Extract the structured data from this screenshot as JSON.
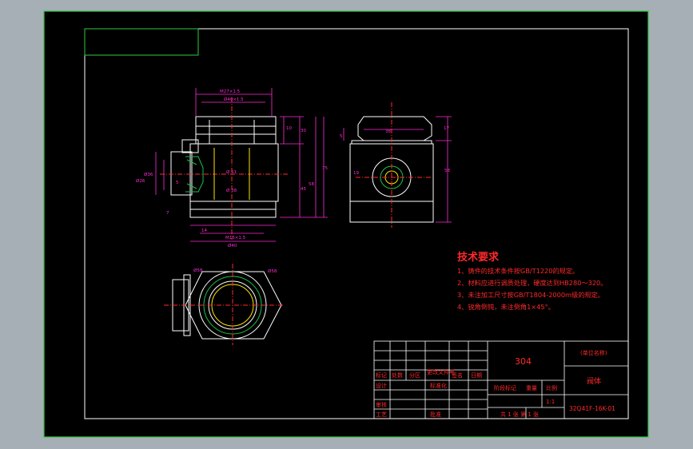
{
  "technical_requirements": {
    "title": "技术要求",
    "items": [
      "1、铸件的技术条件按GB/T1220的规定。",
      "2、材料应进行调质处理，硬度达到HB280～320。",
      "3、未注加工尺寸按GB/T1804-2000m级的规定。",
      "4、锐角倒钝，未注倒角1×45°。"
    ]
  },
  "title_block": {
    "material": "304",
    "company": "(单位名称)",
    "part_name": "阀体",
    "drawing_no": "32Q41F-16K-01",
    "scale": "1:1",
    "sheet_info": "共 1 张  第 1 张",
    "labels": {
      "mark": "标记",
      "count": "处数",
      "zone": "分区",
      "change_doc": "更改文件号",
      "signature": "签名",
      "date": "日期",
      "design": "设计",
      "standardization": "标准化",
      "review": "审核",
      "process": "工艺",
      "approve": "批准",
      "stage_mark": "阶段标记",
      "weight": "重量",
      "scale": "比例"
    }
  },
  "dimensions": {
    "top_1": "M27×1.5",
    "top_2": "Ø40×1.5",
    "side_1": "10",
    "side_2": "30",
    "side_3": "58",
    "side_4": "75",
    "side_5": "45",
    "inner_1": "Ø 51",
    "inner_2": "Ø 38",
    "left_1": "Ø26",
    "left_2": "Ø36",
    "left_3": "5",
    "left_4": "7",
    "bottom_1": "14",
    "bottom_2": "M16×1.5",
    "bottom_3": "Ø40",
    "right_1": "5",
    "right_2": "17",
    "right_3": "58",
    "right_4": "38",
    "right_5": "19",
    "bv_1": "Ø58",
    "bv_2": "Ø58"
  }
}
